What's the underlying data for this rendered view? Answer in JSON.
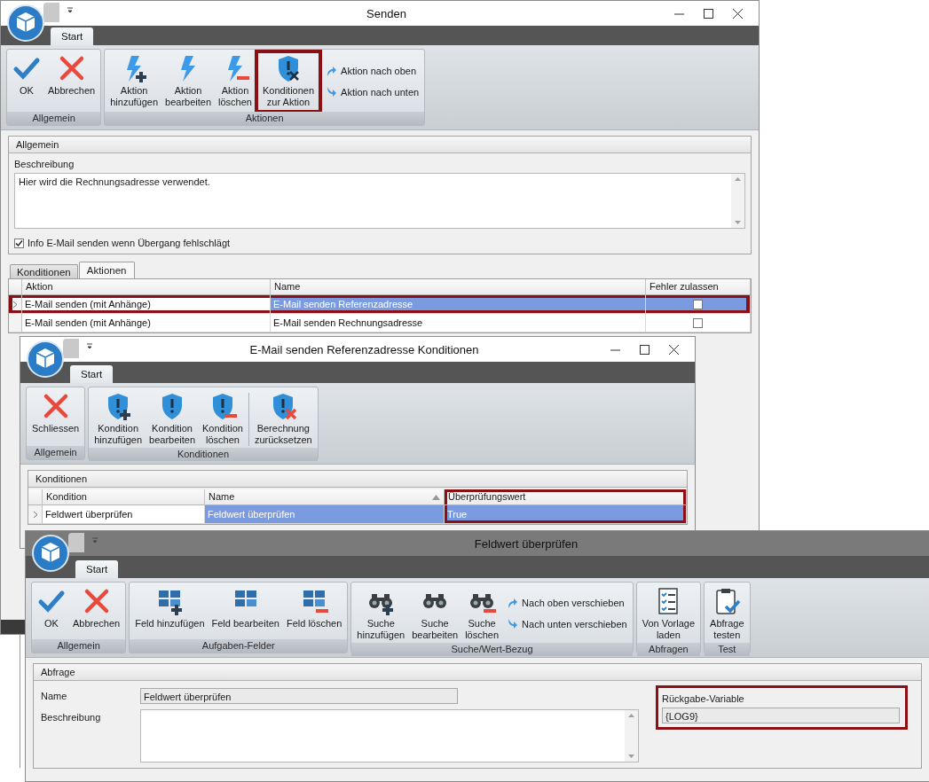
{
  "main_window": {
    "title": "Senden",
    "tab": "Start",
    "groups": [
      {
        "label": "Allgemein",
        "buttons": [
          {
            "kind": "ok",
            "label": "OK"
          },
          {
            "kind": "cancel",
            "label": "Abbrechen"
          }
        ]
      },
      {
        "label": "Aktionen",
        "buttons": [
          {
            "kind": "bolt-add",
            "label": "Aktion\nhinzufügen"
          },
          {
            "kind": "bolt",
            "label": "Aktion\nbearbeiten"
          },
          {
            "kind": "bolt-remove",
            "label": "Aktion\nlöschen"
          },
          {
            "kind": "shield-tools",
            "label": "Konditionen\nzur Aktion",
            "highlighted": true
          }
        ],
        "small_buttons": [
          {
            "kind": "up",
            "label": "Aktion nach oben"
          },
          {
            "kind": "down",
            "label": "Aktion nach unten"
          }
        ]
      }
    ],
    "general": {
      "header": "Allgemein",
      "description_label": "Beschreibung",
      "description": "Hier wird die Rechnungsadresse verwendet.",
      "info_mail": {
        "label": "Info E-Mail senden wenn Übergang fehlschlägt",
        "checked": true
      }
    },
    "tabs": [
      {
        "label": "Konditionen",
        "selected": false
      },
      {
        "label": "Aktionen",
        "selected": true
      }
    ],
    "table": {
      "columns": [
        {
          "label": "Aktion"
        },
        {
          "label": "Name"
        },
        {
          "label": "Fehler zulassen"
        }
      ],
      "rows": [
        {
          "cells": [
            "E-Mail senden (mit Anhänge)",
            "E-Mail senden Referenzadresse"
          ],
          "error_allowed": false,
          "selected": true,
          "highlighted": true
        },
        {
          "cells": [
            "E-Mail senden (mit Anhänge)",
            "E-Mail senden Rechnungsadresse"
          ],
          "error_allowed": false,
          "selected": false,
          "highlighted": false
        }
      ]
    }
  },
  "conditions_window": {
    "title": "E-Mail senden Referenzadresse Konditionen",
    "tab": "Start",
    "groups": [
      {
        "label": "Allgemein",
        "buttons": [
          {
            "kind": "cancel",
            "label": "Schliessen"
          }
        ]
      },
      {
        "label": "Konditionen",
        "buttons": [
          {
            "kind": "shield-add",
            "label": "Kondition\nhinzufügen"
          },
          {
            "kind": "shield",
            "label": "Kondition\nbearbeiten"
          },
          {
            "kind": "shield-remove",
            "label": "Kondition\nlöschen"
          },
          {
            "kind": "shield-x",
            "label": "Berechnung\nzurücksetzen",
            "separator_before": true
          }
        ]
      }
    ],
    "panel_header": "Konditionen",
    "table": {
      "columns": [
        {
          "label": "Kondition",
          "highlighted": false
        },
        {
          "label": "Name",
          "sort_ascending": true,
          "highlighted": false
        },
        {
          "label": "Überprüfungswert",
          "highlighted": true
        }
      ],
      "rows": [
        {
          "cells": [
            "Feldwert überprüfen",
            "Feldwert überprüfen",
            "True"
          ],
          "selected": true
        }
      ]
    }
  },
  "field_window": {
    "title": "Feldwert überprüfen",
    "tab": "Start",
    "groups": [
      {
        "label": "Allgemein",
        "buttons": [
          {
            "kind": "ok",
            "label": "OK"
          },
          {
            "kind": "cancel",
            "label": "Abbrechen"
          }
        ]
      },
      {
        "label": "Aufgaben-Felder",
        "buttons": [
          {
            "kind": "field-add",
            "label": "Feld hinzufügen"
          },
          {
            "kind": "field",
            "label": "Feld bearbeiten"
          },
          {
            "kind": "field-remove",
            "label": "Feld löschen"
          }
        ]
      },
      {
        "label": "Suche/Wert-Bezug",
        "buttons": [
          {
            "kind": "binoculars-add",
            "label": "Suche\nhinzufügen"
          },
          {
            "kind": "binoculars",
            "label": "Suche\nbearbeiten"
          },
          {
            "kind": "binoculars-remove",
            "label": "Suche\nlöschen"
          }
        ],
        "small_buttons": [
          {
            "kind": "up",
            "label": "Nach oben verschieben"
          },
          {
            "kind": "down",
            "label": "Nach unten verschieben"
          }
        ]
      },
      {
        "label": "Abfragen",
        "buttons": [
          {
            "kind": "checklist",
            "label": "Von Vorlage\nladen"
          }
        ]
      },
      {
        "label": "Test",
        "buttons": [
          {
            "kind": "clipboard",
            "label": "Abfrage\ntesten"
          }
        ]
      }
    ],
    "query": {
      "header": "Abfrage",
      "name_label": "Name",
      "name": "Feldwert überprüfen",
      "description_label": "Beschreibung",
      "return_variable": {
        "label": "Rückgabe-Variable",
        "value": "{LOG9}",
        "highlighted": true
      }
    }
  }
}
